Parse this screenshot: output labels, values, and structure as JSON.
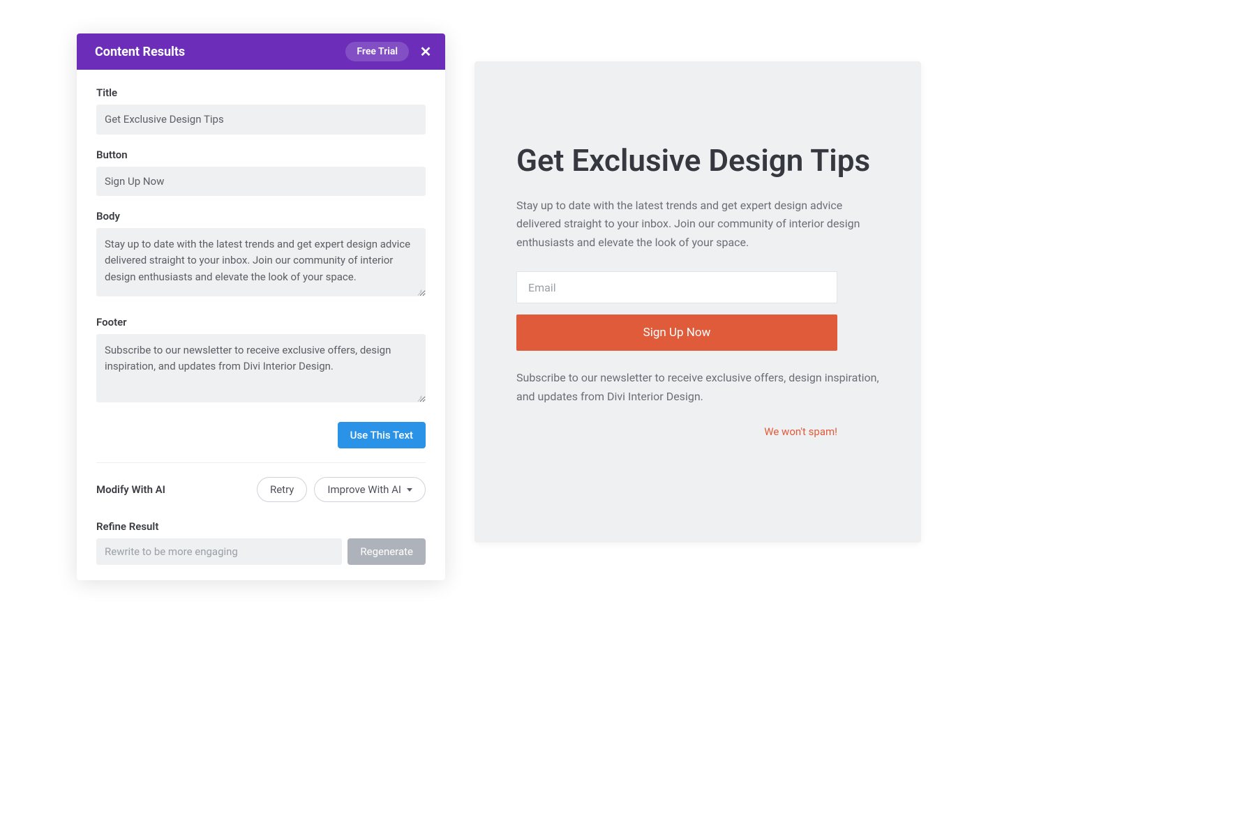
{
  "panel": {
    "header": {
      "title": "Content Results",
      "free_trial": "Free Trial",
      "close": "✕"
    },
    "fields": {
      "title_label": "Title",
      "title_value": "Get Exclusive Design Tips",
      "button_label": "Button",
      "button_value": "Sign Up Now",
      "body_label": "Body",
      "body_value": "Stay up to date with the latest trends and get expert design advice delivered straight to your inbox. Join our community of interior design enthusiasts and elevate the look of your space.",
      "footer_label": "Footer",
      "footer_value": "Subscribe to our newsletter to receive exclusive offers, design inspiration, and updates from Divi Interior Design."
    },
    "use_text": "Use This Text",
    "modify_label": "Modify With AI",
    "retry": "Retry",
    "improve": "Improve With AI",
    "refine_label": "Refine Result",
    "refine_placeholder": "Rewrite to be more engaging",
    "regenerate": "Regenerate"
  },
  "preview": {
    "title": "Get Exclusive Design Tips",
    "body": "Stay up to date with the latest trends and get expert design advice delivered straight to your inbox. Join our community of interior design enthusiasts and elevate the look of your space.",
    "email_placeholder": "Email",
    "button": "Sign Up Now",
    "footer": "Subscribe to our newsletter to receive exclusive offers, design inspiration, and updates from Divi Interior Design.",
    "spam": "We won't spam!"
  }
}
